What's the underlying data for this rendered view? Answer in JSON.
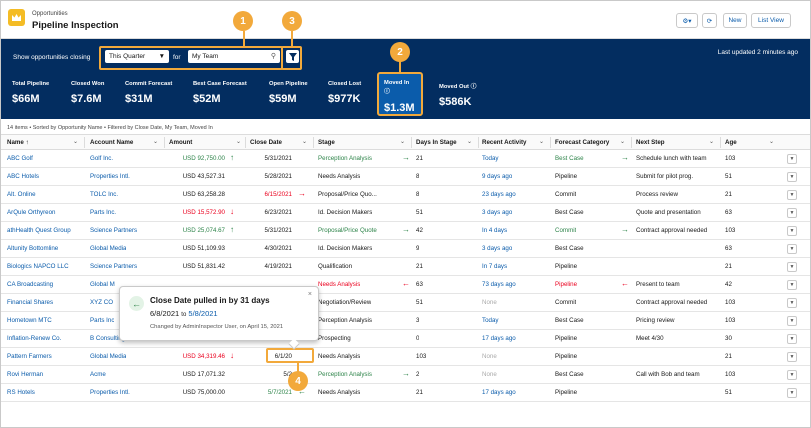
{
  "header": {
    "object_label": "Opportunities",
    "title": "Pipeline Inspection",
    "new_label": "New",
    "list_view_label": "List View"
  },
  "filters": {
    "show_label": "Show opportunities closing",
    "period_value": "This Quarter",
    "for_label": "for",
    "team_value": "My Team",
    "last_updated": "Last updated 2 minutes ago"
  },
  "metrics": [
    {
      "label": "Total Pipeline",
      "value": "$66M"
    },
    {
      "label": "Closed Won",
      "value": "$7.6M"
    },
    {
      "label": "Commit Forecast",
      "value": "$31M"
    },
    {
      "label": "Best Case Forecast",
      "value": "$52M"
    },
    {
      "label": "Open Pipeline",
      "value": "$59M"
    },
    {
      "label": "Closed Lost",
      "value": "$977K"
    },
    {
      "label": "Moved In",
      "value": "$1.3M"
    },
    {
      "label": "Moved Out",
      "value": "$586K"
    }
  ],
  "callouts": [
    "1",
    "2",
    "3",
    "4"
  ],
  "summary": "14 items • Sorted by Opportunity Name • Filtered by Close Date, My Team, Moved In",
  "columns": [
    "Name ↑",
    "Account Name",
    "Amount",
    "Close Date",
    "Stage",
    "Days In Stage",
    "Recent Activity",
    "Forecast Category",
    "Next Step",
    "Age"
  ],
  "rows": [
    {
      "name": "ABC Golf",
      "account": "Golf Inc.",
      "amount": "USD 92,750.00",
      "amt_c": "green",
      "amt_a": "↑",
      "close": "5/31/2021",
      "close_c": "",
      "close_a": "",
      "stage": "Perception Analysis",
      "stage_c": "green",
      "stage_a": "→",
      "days": "21",
      "activity": "Today",
      "act_c": "link",
      "forecast": "Best Case",
      "fc_c": "green",
      "fc_a": "→",
      "next": "Schedule lunch with team",
      "age": "103"
    },
    {
      "name": "ABC Hotels",
      "account": "Properties Intl.",
      "amount": "USD 43,527.31",
      "amt_c": "",
      "amt_a": "",
      "close": "5/28/2021",
      "close_c": "",
      "close_a": "",
      "stage": "Needs Analysis",
      "stage_c": "",
      "stage_a": "",
      "days": "8",
      "activity": "9 days ago",
      "act_c": "link",
      "forecast": "Pipeline",
      "fc_c": "",
      "fc_a": "",
      "next": "Submit for pilot prog.",
      "age": "51"
    },
    {
      "name": "Alt. Online",
      "account": "TOLC Inc.",
      "amount": "USD 63,258.28",
      "amt_c": "",
      "amt_a": "",
      "close": "6/15/2021",
      "close_c": "red",
      "close_a": "→",
      "stage": "Proposal/Price Quo...",
      "stage_c": "",
      "stage_a": "",
      "days": "8",
      "activity": "23 days ago",
      "act_c": "link",
      "forecast": "Commit",
      "fc_c": "",
      "fc_a": "",
      "next": "Process review",
      "age": "21"
    },
    {
      "name": "ArQule Orthyreon",
      "account": "Parts Inc.",
      "amount": "USD 15,572.90",
      "amt_c": "red",
      "amt_a": "↓",
      "close": "6/23/2021",
      "close_c": "",
      "close_a": "",
      "stage": "Id. Decision Makers",
      "stage_c": "",
      "stage_a": "",
      "days": "51",
      "activity": "3 days ago",
      "act_c": "link",
      "forecast": "Best Case",
      "fc_c": "",
      "fc_a": "",
      "next": "Quote and presentation",
      "age": "63"
    },
    {
      "name": "athHealth Quest Group",
      "account": "Science Partners",
      "amount": "USD 25,074.67",
      "amt_c": "green",
      "amt_a": "↑",
      "close": "5/31/2021",
      "close_c": "",
      "close_a": "",
      "stage": "Proposal/Price Quote",
      "stage_c": "green",
      "stage_a": "→",
      "days": "42",
      "activity": "In 4 days",
      "act_c": "link",
      "forecast": "Commit",
      "fc_c": "green",
      "fc_a": "→",
      "next": "Contract approval needed",
      "age": "103"
    },
    {
      "name": "Altunity Bottomline",
      "account": "Global Media",
      "amount": "USD 51,109.93",
      "amt_c": "",
      "amt_a": "",
      "close": "4/30/2021",
      "close_c": "",
      "close_a": "",
      "stage": "Id. Decision Makers",
      "stage_c": "",
      "stage_a": "",
      "days": "9",
      "activity": "3 days ago",
      "act_c": "link",
      "forecast": "Best Case",
      "fc_c": "",
      "fc_a": "",
      "next": "",
      "age": "63"
    },
    {
      "name": "Biologics NAPCO LLC",
      "account": "Science Partners",
      "amount": "USD 51,831.42",
      "amt_c": "",
      "amt_a": "",
      "close": "4/19/2021",
      "close_c": "",
      "close_a": "",
      "stage": "Qualification",
      "stage_c": "",
      "stage_a": "",
      "days": "21",
      "activity": "In 7 days",
      "act_c": "link",
      "forecast": "Pipeline",
      "fc_c": "",
      "fc_a": "",
      "next": "",
      "age": "21"
    },
    {
      "name": "CA Broadcasting",
      "account": "Global M",
      "amount": "",
      "amt_c": "",
      "amt_a": "",
      "close": "",
      "close_c": "",
      "close_a": "",
      "stage": "Needs Analysis",
      "stage_c": "red",
      "stage_a": "←",
      "days": "63",
      "activity": "73 days ago",
      "act_c": "link",
      "forecast": "Pipeline",
      "fc_c": "red",
      "fc_a": "←",
      "next": "Present to team",
      "age": "42"
    },
    {
      "name": "Financial Shares",
      "account": "XYZ CO",
      "amount": "",
      "amt_c": "",
      "amt_a": "",
      "close": "",
      "close_c": "",
      "close_a": "",
      "stage": "Negotiation/Review",
      "stage_c": "",
      "stage_a": "",
      "days": "51",
      "activity": "None",
      "act_c": "muted",
      "forecast": "Commit",
      "fc_c": "",
      "fc_a": "",
      "next": "Contract approval needed",
      "age": "103"
    },
    {
      "name": "Hometown MTC",
      "account": "Parts Inc",
      "amount": "",
      "amt_c": "",
      "amt_a": "",
      "close": "",
      "close_c": "",
      "close_a": "",
      "stage": "Perception Analysis",
      "stage_c": "",
      "stage_a": "",
      "days": "3",
      "activity": "Today",
      "act_c": "link",
      "forecast": "Best Case",
      "fc_c": "",
      "fc_a": "",
      "next": "Pricing review",
      "age": "103"
    },
    {
      "name": "Inflation-Renew Co.",
      "account": "B Consulting",
      "amount": "USD 599,195.13",
      "amt_c": "green",
      "amt_a": "↑",
      "close": "5/8/2021",
      "close_c": "green",
      "close_a": "←",
      "stage": "Prospecting",
      "stage_c": "",
      "stage_a": "",
      "days": "0",
      "activity": "17 days ago",
      "act_c": "link",
      "forecast": "Pipeline",
      "fc_c": "",
      "fc_a": "",
      "next": "Meet 4/30",
      "age": "30"
    },
    {
      "name": "Pattern Farmers",
      "account": "Global Media",
      "amount": "USD 34,319.46",
      "amt_c": "red",
      "amt_a": "↓",
      "close": "6/1/20",
      "close_c": "",
      "close_a": "",
      "stage": "Needs Analysis",
      "stage_c": "",
      "stage_a": "",
      "days": "103",
      "activity": "None",
      "act_c": "muted",
      "forecast": "Pipeline",
      "fc_c": "",
      "fc_a": "",
      "next": "",
      "age": "21"
    },
    {
      "name": "Rovi Herman",
      "account": "Acme",
      "amount": "USD 17,071.32",
      "amt_c": "",
      "amt_a": "",
      "close": "5/2",
      "close_c": "",
      "close_a": "",
      "stage": "Perception Analysis",
      "stage_c": "green",
      "stage_a": "→",
      "days": "2",
      "activity": "None",
      "act_c": "muted",
      "forecast": "Best Case",
      "fc_c": "",
      "fc_a": "",
      "next": "Call with Bob and team",
      "age": "103"
    },
    {
      "name": "RS Hotels",
      "account": "Properties Intl.",
      "amount": "USD 75,000.00",
      "amt_c": "",
      "amt_a": "",
      "close": "5/7/2021",
      "close_c": "green",
      "close_a": "←",
      "stage": "Needs Analysis",
      "stage_c": "",
      "stage_a": "",
      "days": "21",
      "activity": "17 days ago",
      "act_c": "link",
      "forecast": "Pipeline",
      "fc_c": "",
      "fc_a": "",
      "next": "",
      "age": "51"
    }
  ],
  "popover": {
    "title": "Close Date pulled in by 31 days",
    "from": "6/8/2021",
    "to_word": "to",
    "to": "5/8/2021",
    "changed": "Changed by AdminInspector User, on April 15, 2021",
    "close_glyph": "×"
  },
  "colors": {
    "navy": "#032d60",
    "accent": "#f2a93b",
    "link": "#0b5cab",
    "green": "#2e844a",
    "red": "#ea001e",
    "highlight": "#0b5cab"
  }
}
